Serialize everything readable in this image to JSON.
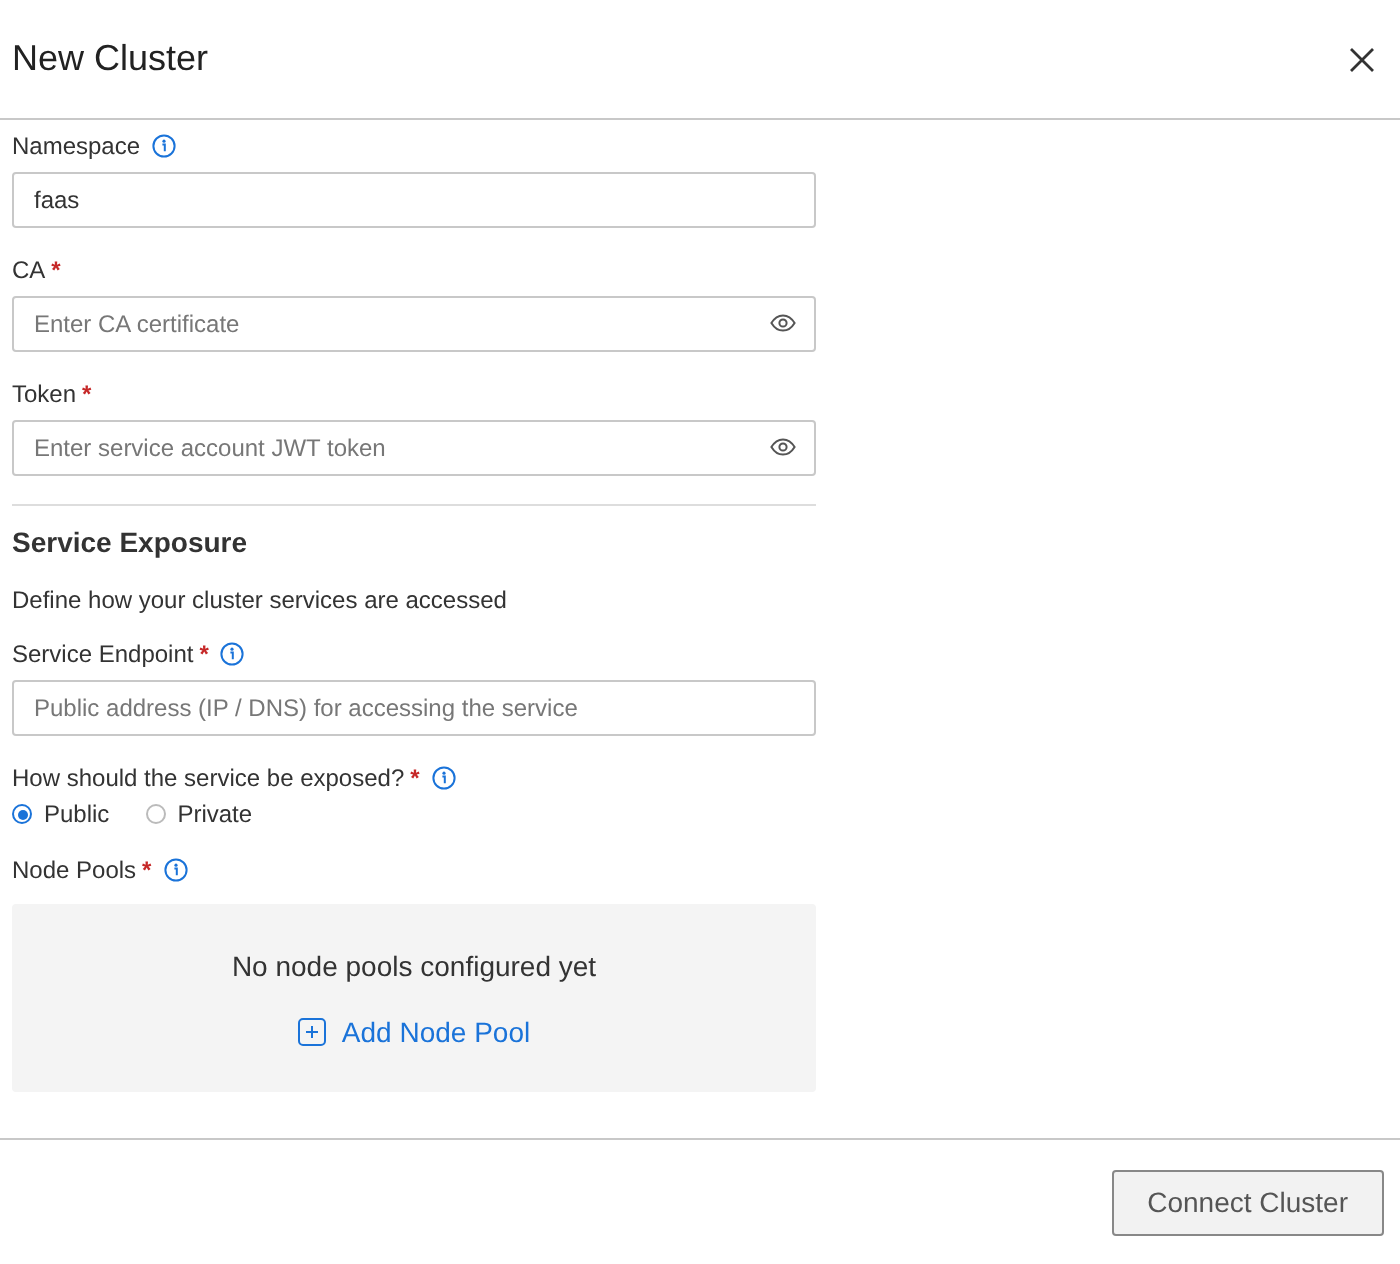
{
  "dialog": {
    "title": "New Cluster"
  },
  "fields": [
    {
      "kind": "input",
      "label": "Namespace",
      "info": true,
      "value": "faas"
    },
    {
      "kind": "secret",
      "label": "CA",
      "required_mark": "*",
      "info": false,
      "placeholder": "Enter CA certificate"
    },
    {
      "kind": "secret",
      "label": "Token",
      "required_mark": "*",
      "info": false,
      "placeholder": "Enter service account JWT token"
    }
  ],
  "section": {
    "title": "Service Exposure",
    "description": "Define how your cluster services are accessed"
  },
  "exposure_fields": [
    {
      "kind": "input",
      "label": "Service Endpoint",
      "required_mark": "*",
      "info": true,
      "placeholder": "Public address (IP / DNS) for accessing the service"
    },
    {
      "kind": "radio",
      "label": "How should the service be exposed?",
      "required_mark": "*",
      "info": true,
      "options": [
        {
          "label": "Public",
          "selected": true
        },
        {
          "label": "Private",
          "selected": false
        }
      ]
    },
    {
      "kind": "empty-list",
      "label": "Node Pools",
      "required_mark": "*",
      "info": true,
      "message": "No node pools configured yet",
      "action": "Add Node Pool"
    }
  ],
  "footer": {
    "button": {
      "label": "Connect Cluster",
      "disabled": true
    }
  }
}
